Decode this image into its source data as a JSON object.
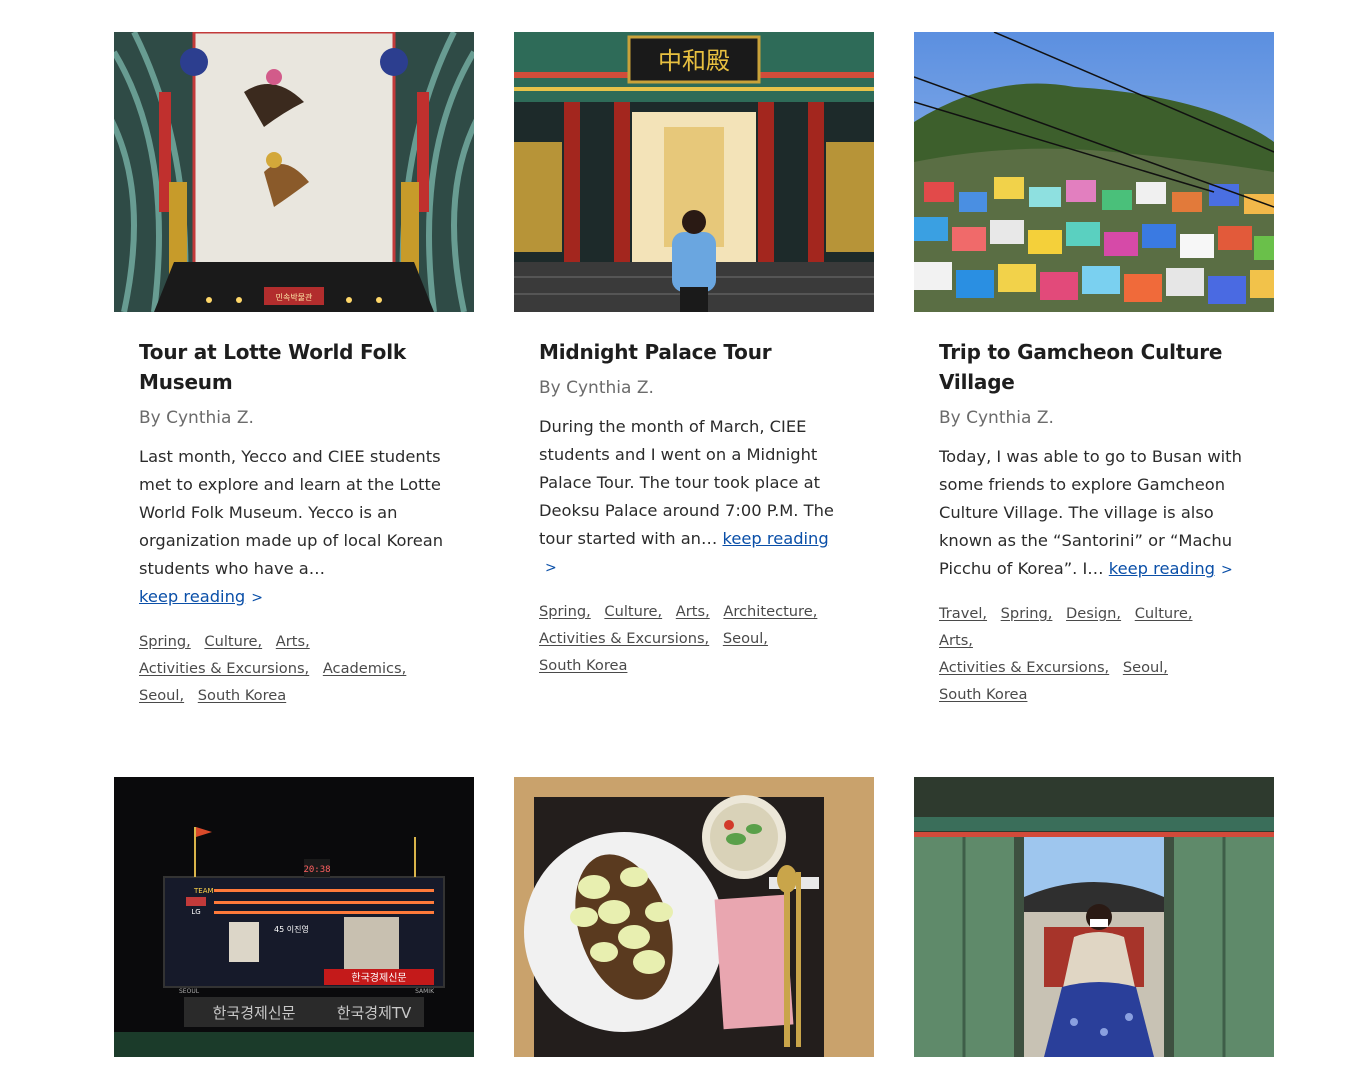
{
  "cards": [
    {
      "title": "Tour at Lotte World Folk Museum",
      "author": "By Cynthia Z.",
      "excerpt": "Last month, Yecco and CIEE students met to explore and learn at the Lotte World Folk Museum. Yecco is an organization made up of local Korean students who have a…",
      "more": "keep reading",
      "chevron": ">",
      "tags": [
        "Spring,",
        "Culture,",
        "Arts,",
        "Activities & Excursions,",
        "Academics,",
        "Seoul,",
        "South Korea"
      ],
      "image_sign": "민속박물관"
    },
    {
      "title": "Midnight Palace Tour",
      "author": "By Cynthia Z.",
      "excerpt": "During the month of March, CIEE students and I went on a Midnight Palace Tour. The tour took place at Deoksu Palace around 7:00 P.M. The tour started with an…",
      "more": "keep reading",
      "chevron": ">",
      "tags": [
        "Spring,",
        "Culture,",
        "Arts,",
        "Architecture,",
        "Activities & Excursions,",
        "Seoul,",
        "South Korea"
      ],
      "image_sign": "中和殿"
    },
    {
      "title": "Trip to Gamcheon Culture Village",
      "author": "By Cynthia Z.",
      "excerpt": "Today, I was able to go to Busan with some friends to explore Gamcheon Culture Village. The village is also known as the “Santorini” or “Machu Picchu of Korea”. I…",
      "more": "keep reading",
      "chevron": ">",
      "tags": [
        "Travel,",
        "Spring,",
        "Design,",
        "Culture,",
        "Arts,",
        "Activities & Excursions,",
        "Seoul,",
        "South Korea"
      ]
    },
    {
      "image_texts": [
        "TEAM",
        "LG",
        "20:38",
        "45 이진영",
        "한국경제신문",
        "한국경제TV",
        "SEOUL",
        "SAMIK"
      ]
    },
    {},
    {}
  ],
  "colors": {
    "link": "#0a4fa8",
    "title": "#1e1e1e",
    "author": "#6b6b6b"
  }
}
